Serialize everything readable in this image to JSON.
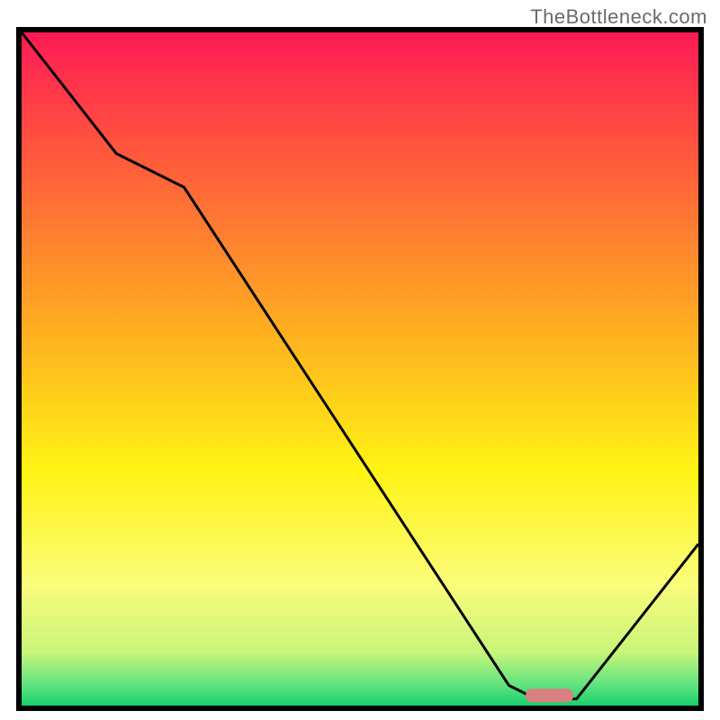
{
  "watermark": "TheBottleneck.com",
  "chart_data": {
    "type": "line",
    "title": "",
    "xlabel": "",
    "ylabel": "",
    "xlim": [
      0,
      100
    ],
    "ylim": [
      0,
      100
    ],
    "grid": false,
    "series": [
      {
        "name": "bottleneck-curve",
        "x": [
          0,
          14,
          24,
          72,
          76,
          82,
          100
        ],
        "values": [
          100,
          82,
          77,
          3,
          1,
          1,
          24
        ],
        "stroke": "#000000"
      }
    ],
    "marker": {
      "name": "optimal-marker",
      "x_center": 78,
      "width": 7,
      "y": 1.5,
      "color": "#d98080"
    },
    "background_gradient": {
      "stops": [
        {
          "offset": 0.0,
          "color": "#ff1a55"
        },
        {
          "offset": 0.2,
          "color": "#ff5e3a"
        },
        {
          "offset": 0.45,
          "color": "#ffb120"
        },
        {
          "offset": 0.65,
          "color": "#fff314"
        },
        {
          "offset": 0.82,
          "color": "#fafc7a"
        },
        {
          "offset": 0.92,
          "color": "#c8f57a"
        },
        {
          "offset": 0.97,
          "color": "#5fe37f"
        },
        {
          "offset": 1.0,
          "color": "#18cf6b"
        }
      ]
    }
  }
}
